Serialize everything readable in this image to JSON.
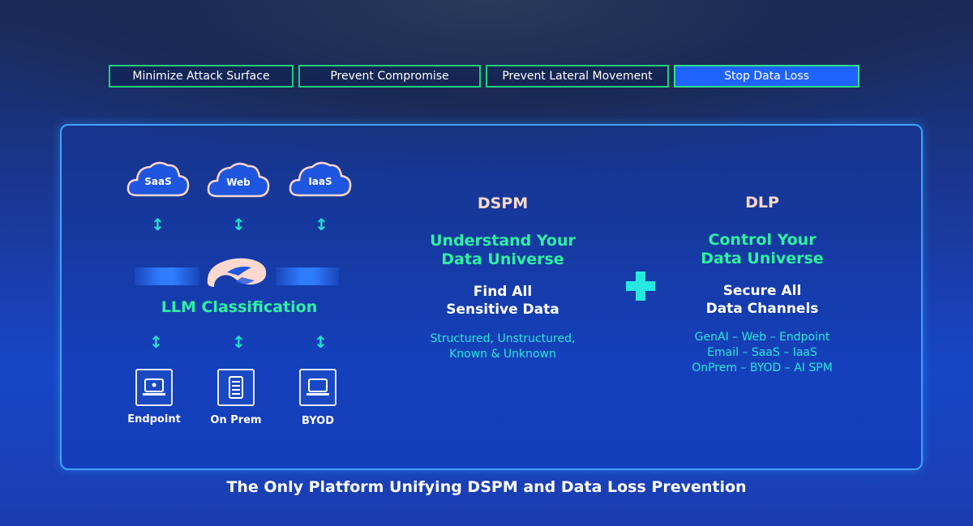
{
  "tabs": [
    {
      "label": "Minimize Attack Surface",
      "active": false
    },
    {
      "label": "Prevent Compromise",
      "active": false
    },
    {
      "label": "Prevent Lateral Movement",
      "active": false
    },
    {
      "label": "Stop Data Loss",
      "active": true
    }
  ],
  "clouds": [
    "SaaS",
    "Web",
    "IaaS"
  ],
  "classification_label": "LLM Classification",
  "devices": [
    "Endpoint",
    "On Prem",
    "BYOD"
  ],
  "dspm": {
    "title": "DSPM",
    "headline_line1": "Understand Your",
    "headline_line2": "Data Universe",
    "subhead_line1": "Find All",
    "subhead_line2": "Sensitive Data",
    "detail_line1": "Structured, Unstructured,",
    "detail_line2": "Known & Unknown"
  },
  "dlp": {
    "title": "DLP",
    "headline_line1": "Control Your",
    "headline_line2": "Data Universe",
    "subhead_line1": "Secure All",
    "subhead_line2": "Data Channels",
    "detail_line1": "GenAI – Web – Endpoint",
    "detail_line2": "Email – SaaS – IaaS",
    "detail_line3": "OnPrem – BYOD – AI SPM"
  },
  "footer": "The Only Platform Unifying DSPM and Data Loss Prevention",
  "colors": {
    "accent_green": "#2ef0a0",
    "accent_cyan": "#27e8d8",
    "tab_active": "#1f63ff",
    "panel_border": "#3fa3ff"
  }
}
